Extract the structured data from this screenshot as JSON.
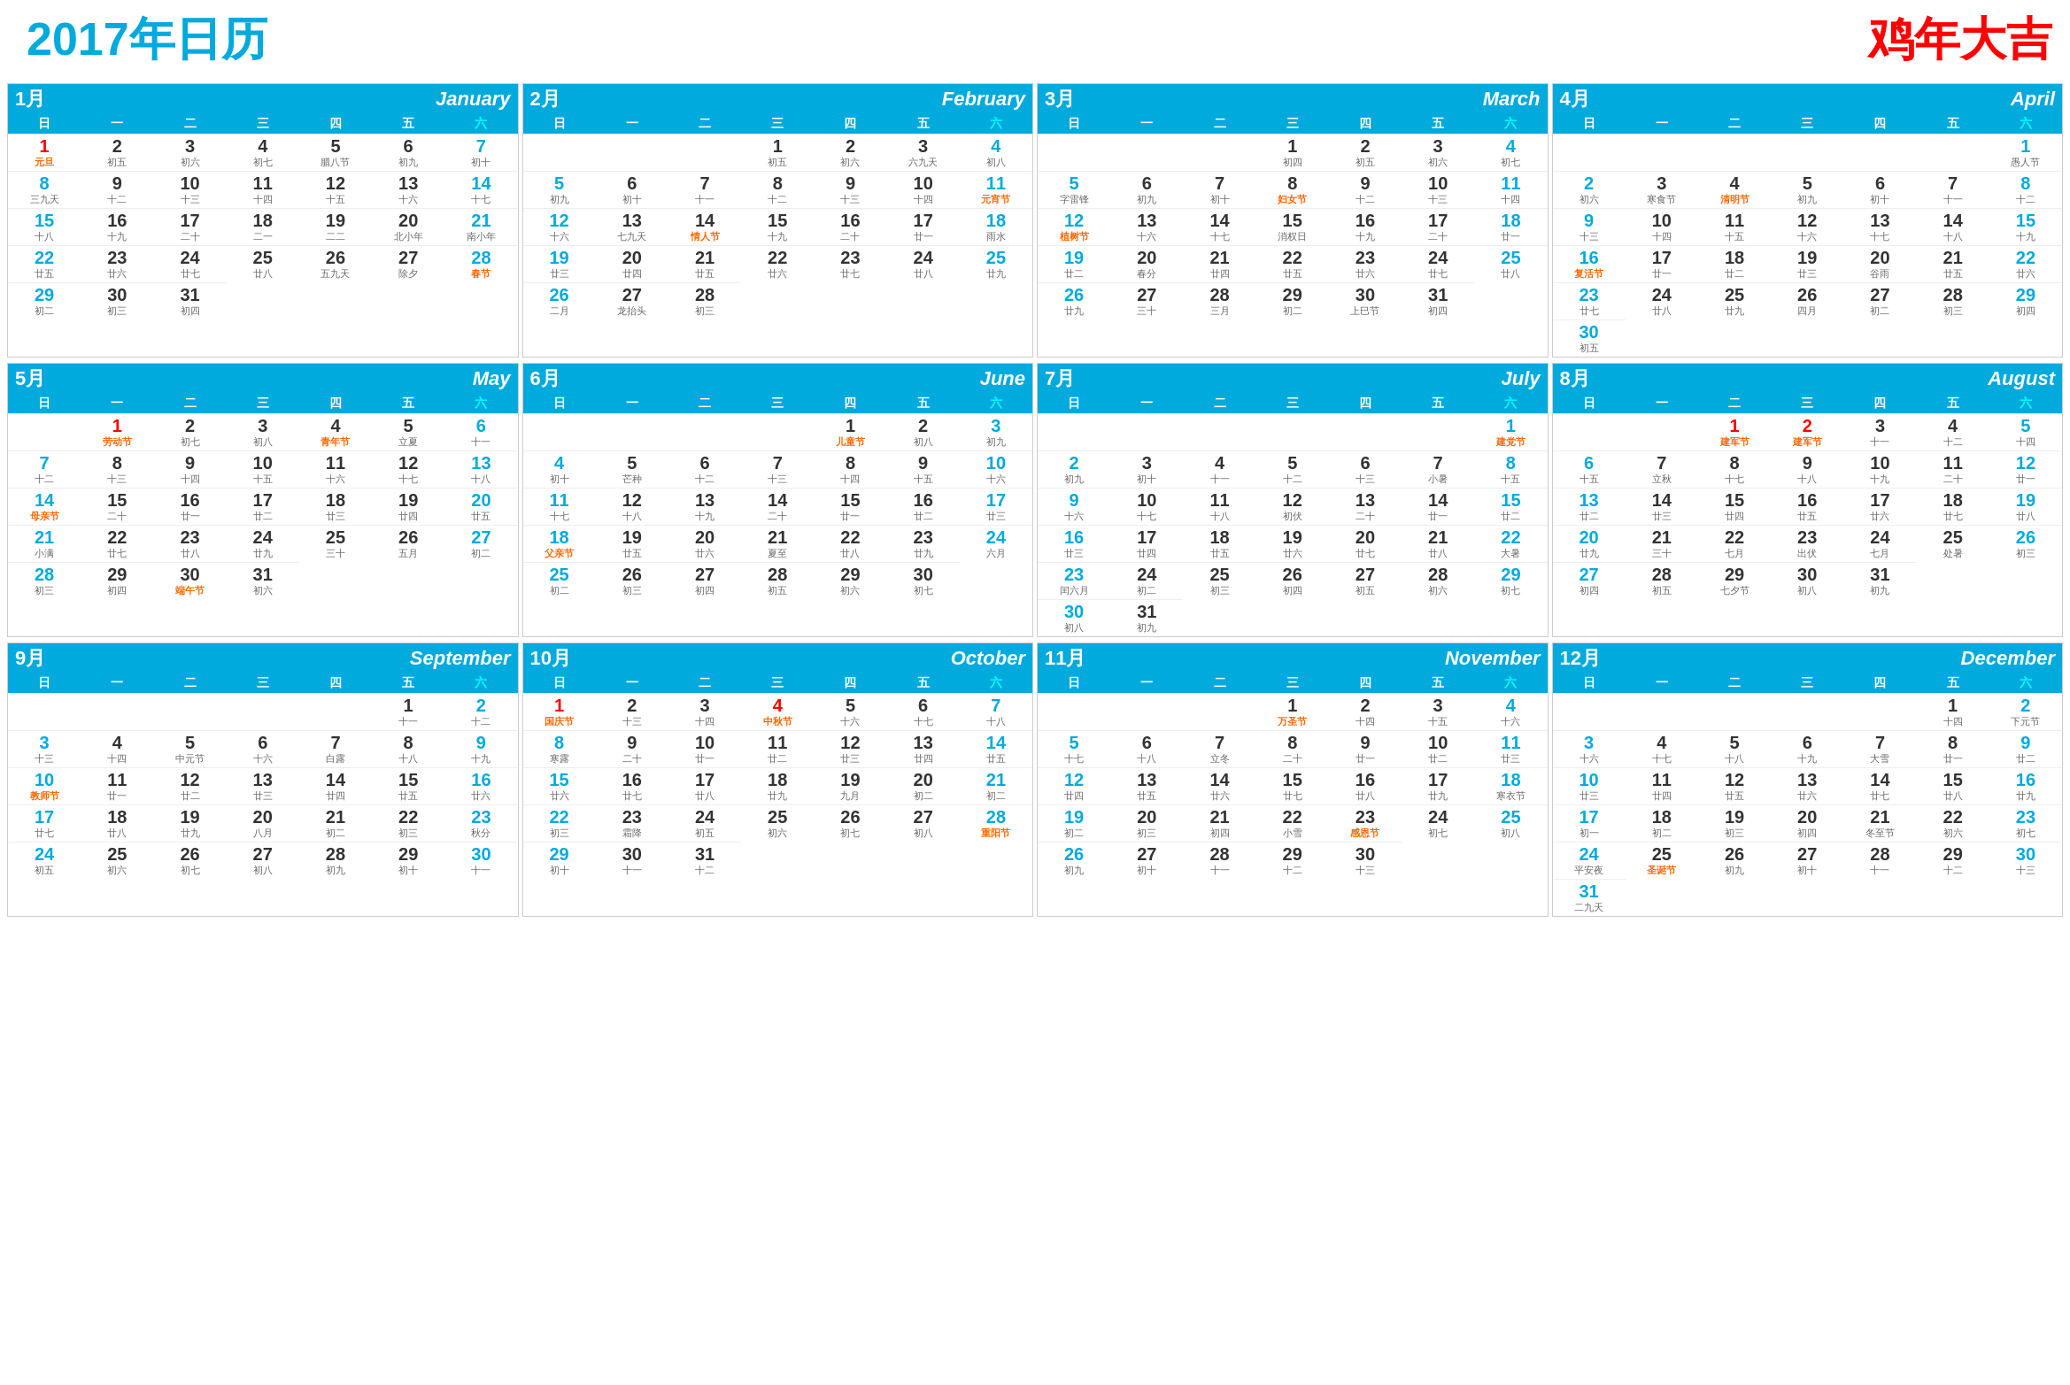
{
  "title": "2017年日历",
  "subtitle": "鸡年大吉",
  "months": [
    {
      "cn": "1月",
      "en": "January",
      "startDay": 0,
      "days": 31,
      "notes": {
        "1": "元旦",
        "2": "初五",
        "3": "初六",
        "4": "初七",
        "5": "腊八节",
        "6": "初九",
        "7": "初十",
        "8": "三九天",
        "9": "十二",
        "10": "十三",
        "11": "十四",
        "12": "十五",
        "13": "十六",
        "14": "十七",
        "15": "十八",
        "16": "十九",
        "17": "二十",
        "18": "二一",
        "19": "二二",
        "20": "北小年",
        "21": "南小年",
        "22": "廿五",
        "23": "廿六",
        "24": "廿七",
        "25": "廿八",
        "26": "五九天",
        "27": "除夕",
        "28": "春节",
        "29": "初二",
        "30": "初三",
        "31": "初四"
      }
    },
    {
      "cn": "2月",
      "en": "February",
      "startDay": 3,
      "days": 28,
      "notes": {
        "1": "初五",
        "2": "初六",
        "3": "六九天",
        "4": "初八",
        "5": "初九",
        "6": "初十",
        "7": "十一",
        "8": "十二",
        "9": "十三",
        "10": "十四",
        "11": "元宵节",
        "12": "十六",
        "13": "七九天",
        "14": "情人节",
        "15": "十九",
        "16": "二十",
        "17": "廿一",
        "18": "雨水",
        "19": "廿三",
        "20": "廿四",
        "21": "廿五",
        "22": "廿六",
        "23": "廿七",
        "24": "廿八",
        "25": "廿九",
        "26": "二月",
        "27": "龙抬头",
        "28": "初三"
      }
    },
    {
      "cn": "3月",
      "en": "March",
      "startDay": 3,
      "days": 31,
      "notes": {
        "1": "初四",
        "2": "初五",
        "3": "初六",
        "4": "初七",
        "5": "字雷锋",
        "6": "初九",
        "7": "初十",
        "8": "妇女节",
        "9": "十二",
        "10": "十三",
        "11": "十四",
        "12": "植树节",
        "13": "十六",
        "14": "十七",
        "15": "消权日",
        "16": "十九",
        "17": "二十",
        "18": "廿一",
        "19": "廿二",
        "20": "春分",
        "21": "廿四",
        "22": "廿五",
        "23": "廿六",
        "24": "廿七",
        "25": "廿八",
        "26": "廿九",
        "27": "三十",
        "28": "三月",
        "29": "初二",
        "30": "上巳节",
        "31": "初四"
      }
    },
    {
      "cn": "4月",
      "en": "April",
      "startDay": 6,
      "days": 30,
      "notes": {
        "1": "愚人节",
        "2": "初六",
        "3": "寒食节",
        "4": "清明节",
        "5": "初九",
        "6": "初十",
        "7": "十一",
        "8": "十二",
        "9": "十三",
        "10": "十四",
        "11": "十五",
        "12": "十六",
        "13": "十七",
        "14": "十八",
        "15": "十九",
        "16": "复活节",
        "17": "廿一",
        "18": "廿二",
        "19": "廿三",
        "20": "谷雨",
        "21": "廿五",
        "22": "廿六",
        "23": "廿七",
        "24": "廿八",
        "25": "廿九",
        "26": "四月",
        "27": "初二",
        "28": "初三",
        "29": "初四",
        "30": "初五"
      }
    },
    {
      "cn": "5月",
      "en": "May",
      "startDay": 1,
      "days": 31,
      "notes": {
        "1": "劳动节",
        "2": "初七",
        "3": "初八",
        "4": "青年节",
        "5": "立夏",
        "6": "十一",
        "7": "十二",
        "8": "十三",
        "9": "十四",
        "10": "十五",
        "11": "十六",
        "12": "十七",
        "13": "十八",
        "14": "母亲节",
        "15": "二十",
        "16": "廿一",
        "17": "廿二",
        "18": "廿三",
        "19": "廿四",
        "20": "廿五",
        "21": "小满",
        "22": "廿七",
        "23": "廿八",
        "24": "廿九",
        "25": "三十",
        "26": "五月",
        "27": "初二",
        "28": "初三",
        "29": "初四",
        "30": "端午节",
        "31": "初六"
      }
    },
    {
      "cn": "6月",
      "en": "June",
      "startDay": 4,
      "days": 30,
      "notes": {
        "1": "儿童节",
        "2": "初八",
        "3": "初九",
        "4": "初十",
        "5": "芒种",
        "6": "十二",
        "7": "十三",
        "8": "十四",
        "9": "十五",
        "10": "十六",
        "11": "十七",
        "12": "十八",
        "13": "十九",
        "14": "二十",
        "15": "廿一",
        "16": "廿二",
        "17": "廿三",
        "18": "父亲节",
        "19": "廿五",
        "20": "廿六",
        "21": "夏至",
        "22": "廿八",
        "23": "廿九",
        "24": "六月",
        "25": "初二",
        "26": "初三",
        "27": "初四",
        "28": "初五",
        "29": "初六",
        "30": "初七"
      }
    },
    {
      "cn": "7月",
      "en": "July",
      "startDay": 6,
      "days": 31,
      "notes": {
        "1": "建党节",
        "2": "初九",
        "3": "初十",
        "4": "十一",
        "5": "十二",
        "6": "十三",
        "7": "小暑",
        "8": "十五",
        "9": "十六",
        "10": "十七",
        "11": "十八",
        "12": "初伏",
        "13": "二十",
        "14": "廿一",
        "15": "廿二",
        "16": "廿三",
        "17": "廿四",
        "18": "廿五",
        "19": "廿六",
        "20": "廿七",
        "21": "廿八",
        "22": "大暑",
        "23": "闰六月",
        "24": "初二",
        "25": "初三",
        "26": "初四",
        "27": "初五",
        "28": "初六",
        "29": "初七",
        "30": "初八",
        "31": "初九"
      }
    },
    {
      "cn": "8月",
      "en": "August",
      "startDay": 2,
      "days": 31,
      "notes": {
        "1": "建军节",
        "2": "建军节",
        "3": "十一",
        "4": "十二",
        "5": "十四",
        "6": "十五",
        "7": "立秋",
        "8": "十七",
        "9": "十八",
        "10": "十九",
        "11": "二十",
        "12": "廿一",
        "13": "廿二",
        "14": "廿三",
        "15": "廿四",
        "16": "廿五",
        "17": "廿六",
        "18": "廿七",
        "19": "廿八",
        "20": "廿九",
        "21": "三十",
        "22": "七月",
        "23": "出伏",
        "24": "七月",
        "25": "处暑",
        "26": "初三",
        "27": "初四",
        "28": "初五",
        "29": "七夕节",
        "30": "初八",
        "31": "初九"
      }
    },
    {
      "cn": "9月",
      "en": "September",
      "startDay": 5,
      "days": 30,
      "notes": {
        "1": "十一",
        "2": "十二",
        "3": "十三",
        "4": "十四",
        "5": "中元节",
        "6": "十六",
        "7": "白露",
        "8": "十八",
        "9": "十九",
        "10": "教师节",
        "11": "廿一",
        "12": "廿二",
        "13": "廿三",
        "14": "廿四",
        "15": "廿五",
        "16": "廿六",
        "17": "廿七",
        "18": "廿八",
        "19": "廿九",
        "20": "八月",
        "21": "初二",
        "22": "初三",
        "23": "秋分",
        "24": "初五",
        "25": "初六",
        "26": "初七",
        "27": "初八",
        "28": "初九",
        "29": "初十",
        "30": "十一"
      }
    },
    {
      "cn": "10月",
      "en": "October",
      "startDay": 0,
      "days": 31,
      "notes": {
        "1": "国庆节",
        "2": "十三",
        "3": "十四",
        "4": "中秋节",
        "5": "十六",
        "6": "十七",
        "7": "十八",
        "8": "寒露",
        "9": "二十",
        "10": "廿一",
        "11": "廿二",
        "12": "廿三",
        "13": "廿四",
        "14": "廿五",
        "15": "廿六",
        "16": "廿七",
        "17": "廿八",
        "18": "廿九",
        "19": "九月",
        "20": "初二",
        "21": "初二",
        "22": "初三",
        "23": "霜降",
        "24": "初五",
        "25": "初六",
        "26": "初七",
        "27": "初八",
        "28": "重阳节",
        "29": "初十",
        "30": "十一",
        "31": "十二"
      }
    },
    {
      "cn": "11月",
      "en": "November",
      "startDay": 3,
      "days": 30,
      "notes": {
        "1": "万圣节",
        "2": "十四",
        "3": "十五",
        "4": "十六",
        "5": "十七",
        "6": "十八",
        "7": "立冬",
        "8": "二十",
        "9": "廿一",
        "10": "廿二",
        "11": "廿三",
        "12": "廿四",
        "13": "廿五",
        "14": "廿六",
        "15": "廿七",
        "16": "廿八",
        "17": "廿九",
        "18": "寒衣节",
        "19": "初二",
        "20": "初三",
        "21": "初四",
        "22": "小雪",
        "23": "感恩节",
        "24": "初七",
        "25": "初八",
        "26": "初九",
        "27": "初十",
        "28": "十一",
        "29": "十二",
        "30": "十三"
      }
    },
    {
      "cn": "12月",
      "en": "December",
      "startDay": 5,
      "days": 31,
      "notes": {
        "1": "十四",
        "2": "下元节",
        "3": "十六",
        "4": "十七",
        "5": "十八",
        "6": "十九",
        "7": "大雪",
        "8": "廿一",
        "9": "廿二",
        "10": "廿三",
        "11": "廿四",
        "12": "廿五",
        "13": "廿六",
        "14": "廿七",
        "15": "廿八",
        "16": "廿九",
        "17": "初一",
        "18": "初二",
        "19": "初三",
        "20": "初四",
        "21": "冬至节",
        "22": "初六",
        "23": "初七",
        "24": "平安夜",
        "25": "圣诞节",
        "26": "初九",
        "27": "初十",
        "28": "十一",
        "29": "十二",
        "30": "十三",
        "31": "二九天"
      }
    }
  ],
  "weekdays": [
    "日",
    "一",
    "二",
    "三",
    "四",
    "五",
    "六"
  ],
  "colors": {
    "header_bg": "#00aadd",
    "header_text": "#ffffff",
    "sunday": "#00aadd",
    "saturday": "#00ccff",
    "holiday_red": "#ff0000",
    "title_blue": "#00aadd",
    "title_red": "#ff0000"
  }
}
